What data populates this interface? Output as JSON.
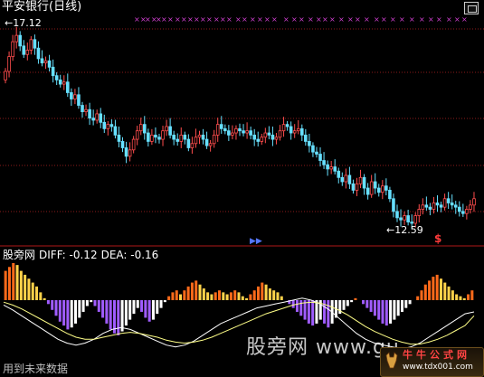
{
  "window": {
    "title": "平安银行(日线)"
  },
  "price_panel": {
    "high_label": "17.12",
    "low_label": "12.59"
  },
  "macd_panel": {
    "name": "股旁网",
    "diff_label": "DIFF: -0.12",
    "dea_label": "DEA: -0.16"
  },
  "markers": {
    "dollar": "$",
    "play": "▶▶"
  },
  "note": "用到未来数据",
  "watermark": "股旁网 www.gu",
  "badge": {
    "name": "牛牛公式网",
    "url": "www.tdx001.com"
  },
  "colors": {
    "background": "#000000",
    "candle_up": "#ff4d4d",
    "candle_down": "#66e0ff",
    "grid": "#8b1a1a",
    "separator": "#b01818",
    "signal_x": "#d040d0",
    "macd_orange": "#ff6a1a",
    "macd_yellow": "#ffd24a",
    "macd_purple": "#a05cff",
    "macd_white": "#ffffff",
    "diff_line": "#ffffff",
    "dea_line": "#ffff88"
  },
  "chart_data": [
    {
      "type": "candlestick",
      "title": "平安银行(日线)",
      "ylim": [
        12.3,
        17.5
      ],
      "grid": true,
      "annotations": [
        {
          "text": "17.12",
          "x": 4,
          "y": 17.12
        },
        {
          "text": "12.59",
          "x": 111,
          "y": 12.59
        }
      ],
      "series": [
        {
          "close": [
            16.2,
            16.55,
            16.9,
            17.05,
            16.8,
            16.6,
            16.7,
            16.95,
            16.75,
            16.5,
            16.4,
            16.45,
            16.3,
            16.1,
            16.0,
            15.9,
            15.95,
            15.7,
            15.55,
            15.65,
            15.4,
            15.25,
            15.3,
            15.1,
            15.05,
            15.2,
            15.0,
            14.85,
            14.95,
            14.9,
            14.7,
            14.55,
            14.4,
            14.2,
            14.35,
            14.6,
            14.8,
            14.95,
            14.75,
            14.55,
            14.7,
            14.65,
            14.6,
            14.8,
            14.9,
            14.7,
            14.6,
            14.55,
            14.7,
            14.6,
            14.4,
            14.5,
            14.65,
            14.7,
            14.6,
            14.45,
            14.5,
            14.7,
            14.95,
            14.85,
            14.8,
            14.7,
            14.75,
            14.85,
            14.8,
            14.75,
            14.8,
            14.7,
            14.6,
            14.55,
            14.65,
            14.75,
            14.7,
            14.6,
            14.65,
            14.8,
            14.95,
            14.9,
            14.75,
            14.8,
            14.85,
            14.7,
            14.55,
            14.45,
            14.3,
            14.25,
            14.1,
            14.0,
            13.9,
            13.95,
            13.85,
            13.7,
            13.6,
            13.75,
            13.55,
            13.4,
            13.55,
            13.7,
            13.45,
            13.3,
            13.6,
            13.45,
            13.35,
            13.5,
            13.4,
            13.2,
            12.9,
            12.75,
            12.7,
            12.8,
            12.65,
            12.62,
            12.8,
            12.95,
            13.05,
            13.0,
            12.95,
            13.1,
            13.05,
            13.0,
            13.2,
            13.1,
            13.05,
            13.0,
            12.9,
            12.85,
            12.95,
            13.05,
            13.2
          ],
          "open": [
            16.0,
            16.2,
            16.55,
            16.9,
            17.05,
            16.8,
            16.6,
            16.7,
            16.95,
            16.75,
            16.5,
            16.4,
            16.45,
            16.3,
            16.1,
            16.0,
            15.9,
            15.95,
            15.7,
            15.55,
            15.65,
            15.4,
            15.25,
            15.3,
            15.1,
            15.05,
            15.2,
            15.0,
            14.85,
            14.95,
            14.9,
            14.7,
            14.55,
            14.4,
            14.2,
            14.35,
            14.6,
            14.8,
            14.95,
            14.75,
            14.55,
            14.7,
            14.65,
            14.6,
            14.8,
            14.9,
            14.7,
            14.6,
            14.55,
            14.7,
            14.6,
            14.4,
            14.5,
            14.65,
            14.7,
            14.6,
            14.45,
            14.5,
            14.7,
            14.95,
            14.85,
            14.8,
            14.7,
            14.75,
            14.85,
            14.8,
            14.75,
            14.8,
            14.7,
            14.6,
            14.55,
            14.65,
            14.75,
            14.7,
            14.6,
            14.65,
            14.8,
            14.95,
            14.9,
            14.75,
            14.8,
            14.85,
            14.7,
            14.55,
            14.45,
            14.3,
            14.25,
            14.1,
            14.0,
            13.9,
            13.95,
            13.85,
            13.7,
            13.6,
            13.75,
            13.55,
            13.4,
            13.55,
            13.7,
            13.45,
            13.3,
            13.6,
            13.45,
            13.35,
            13.5,
            13.4,
            13.2,
            12.9,
            12.75,
            12.7,
            12.8,
            12.65,
            12.62,
            12.8,
            12.95,
            13.05,
            13.0,
            12.95,
            13.1,
            13.05,
            13.0,
            13.2,
            13.1,
            13.05,
            13.0,
            12.9,
            12.85,
            12.95,
            13.05
          ]
        }
      ]
    },
    {
      "type": "bar",
      "title": "股旁网",
      "annotations": [
        "DIFF: -0.12",
        "DEA: -0.16"
      ],
      "ylim": [
        -0.55,
        0.45
      ],
      "values": [
        0.3,
        0.34,
        0.38,
        0.36,
        0.3,
        0.26,
        0.22,
        0.18,
        0.14,
        0.08,
        0.02,
        -0.04,
        -0.1,
        -0.16,
        -0.22,
        -0.26,
        -0.3,
        -0.28,
        -0.24,
        -0.18,
        -0.12,
        -0.06,
        -0.02,
        -0.06,
        -0.12,
        -0.18,
        -0.24,
        -0.3,
        -0.34,
        -0.36,
        -0.32,
        -0.26,
        -0.2,
        -0.14,
        -0.08,
        -0.12,
        -0.18,
        -0.22,
        -0.2,
        -0.14,
        -0.08,
        -0.02,
        0.04,
        0.08,
        0.1,
        0.06,
        0.1,
        0.14,
        0.18,
        0.2,
        0.16,
        0.12,
        0.08,
        0.06,
        0.08,
        0.1,
        0.08,
        0.06,
        0.08,
        0.1,
        0.08,
        0.04,
        0.02,
        0.06,
        0.1,
        0.14,
        0.18,
        0.16,
        0.12,
        0.1,
        0.08,
        0.04,
        0.0,
        -0.04,
        -0.08,
        -0.12,
        -0.16,
        -0.2,
        -0.24,
        -0.26,
        -0.24,
        -0.2,
        -0.24,
        -0.28,
        -0.24,
        -0.18,
        -0.14,
        -0.1,
        -0.06,
        -0.02,
        0.02,
        0.0,
        -0.04,
        -0.08,
        -0.12,
        -0.16,
        -0.2,
        -0.24,
        -0.26,
        -0.24,
        -0.2,
        -0.16,
        -0.12,
        -0.08,
        -0.04,
        0.0,
        0.04,
        0.1,
        0.16,
        0.2,
        0.24,
        0.26,
        0.22,
        0.18,
        0.14,
        0.1,
        0.06,
        0.04,
        0.02,
        0.06,
        0.1
      ],
      "series": [
        {
          "name": "DIFF",
          "values": [
            -0.05,
            -0.1,
            -0.16,
            -0.22,
            -0.28,
            -0.34,
            -0.4,
            -0.44,
            -0.46,
            -0.44,
            -0.4,
            -0.34,
            -0.3,
            -0.28,
            -0.3,
            -0.34,
            -0.38,
            -0.42,
            -0.46,
            -0.48,
            -0.46,
            -0.42,
            -0.36,
            -0.3,
            -0.24,
            -0.2,
            -0.16,
            -0.12,
            -0.08,
            -0.06,
            -0.04,
            -0.02,
            0.0,
            0.02,
            0.0,
            -0.04,
            -0.1,
            -0.18,
            -0.26,
            -0.34,
            -0.4,
            -0.44,
            -0.46,
            -0.48,
            -0.5,
            -0.48,
            -0.44,
            -0.38,
            -0.32,
            -0.26,
            -0.2,
            -0.14,
            -0.12
          ]
        },
        {
          "name": "DEA",
          "values": [
            -0.02,
            -0.05,
            -0.09,
            -0.14,
            -0.19,
            -0.24,
            -0.29,
            -0.34,
            -0.38,
            -0.4,
            -0.4,
            -0.38,
            -0.36,
            -0.34,
            -0.33,
            -0.34,
            -0.36,
            -0.38,
            -0.41,
            -0.43,
            -0.44,
            -0.43,
            -0.41,
            -0.38,
            -0.34,
            -0.3,
            -0.26,
            -0.22,
            -0.18,
            -0.14,
            -0.11,
            -0.08,
            -0.05,
            -0.03,
            -0.02,
            -0.03,
            -0.06,
            -0.1,
            -0.15,
            -0.21,
            -0.27,
            -0.32,
            -0.36,
            -0.4,
            -0.43,
            -0.45,
            -0.45,
            -0.43,
            -0.4,
            -0.36,
            -0.31,
            -0.26,
            -0.16
          ]
        }
      ]
    }
  ]
}
